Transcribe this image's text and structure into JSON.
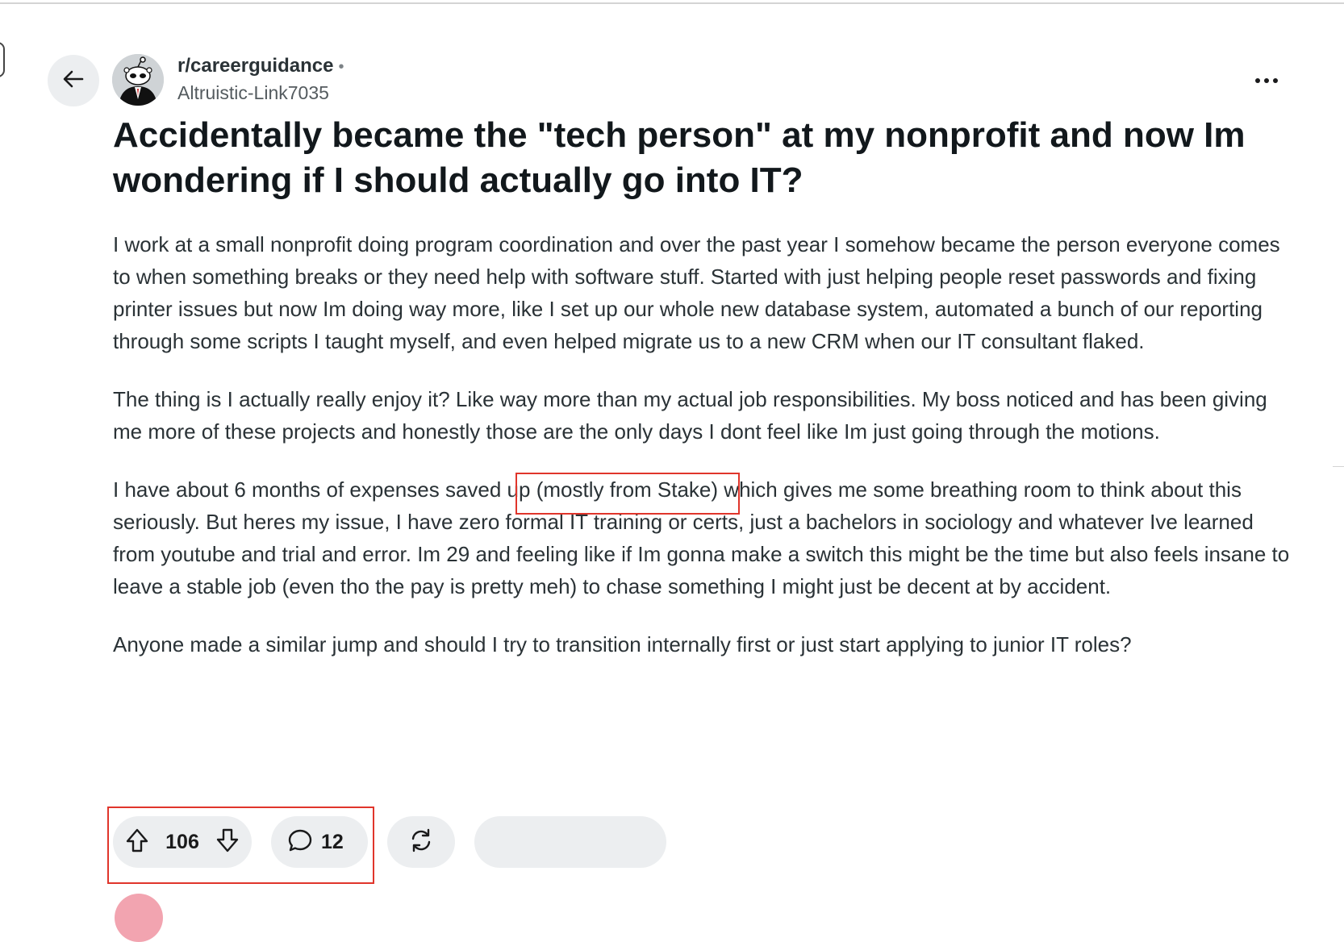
{
  "post": {
    "subreddit": "r/careerguidance",
    "separator": "•",
    "author": "Altruistic-Link7035",
    "title": "Accidentally became the \"tech person\" at my nonprofit and now Im wondering if I should actually go into IT?",
    "paragraphs": {
      "p1": "I work at a small nonprofit doing program coordination and over the past year I somehow became the person everyone comes to when something breaks or they need help with software stuff. Started with just helping people reset passwords and fixing printer issues but now Im doing way more, like I set up our whole new database system, automated a bunch of our reporting through some scripts I taught myself, and even helped migrate us to a new CRM when our IT consultant flaked.",
      "p2": "The thing is I actually really enjoy it? Like way more than my actual job responsibilities. My boss noticed and has been giving me more of these projects and honestly those are the only days I dont feel like Im just going through the motions.",
      "p3_before": "I have about 6 months of expenses saved up ",
      "p3_highlight": "(mostly from Stake)",
      "p3_after": " which gives me some breathing room to think about this seriously. But heres my issue, I have zero formal IT training or certs, just a bachelors in sociology and whatever Ive learned from youtube and trial and error. Im 29 and feeling like if Im gonna make a switch this might be the time but also feels insane to leave a stable job (even tho the pay is pretty meh) to chase something I might just be decent at by accident.",
      "p4": "Anyone made a similar jump and should I try to transition internally first or just start applying to junior IT roles?"
    }
  },
  "actions": {
    "votes": "106",
    "comments": "12"
  },
  "icons": {
    "back": "arrow-left-icon",
    "more": "ellipsis-icon",
    "upvote": "upvote-arrow-icon",
    "downvote": "downvote-arrow-icon",
    "comment": "comment-bubble-icon",
    "share": "crosspost-icon"
  },
  "colors": {
    "highlight_box": "#e0352b",
    "pill_bg": "#eceef0",
    "text": "#2a3236"
  }
}
